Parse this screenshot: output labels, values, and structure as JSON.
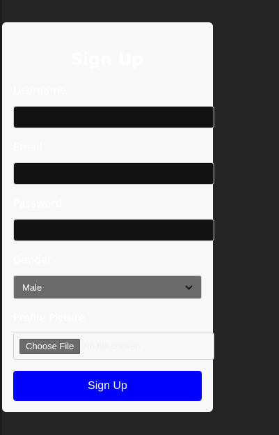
{
  "form": {
    "title": "Sign Up",
    "username_label": "Username",
    "username_value": "",
    "email_label": "Email",
    "email_value": "",
    "password_label": "Password",
    "password_value": "",
    "gender_label": "Gender",
    "gender_selected": "Male",
    "profile_label": "Profile Picture",
    "file_button_label": "Choose File",
    "file_status": "No file chosen",
    "submit_label": "Sign Up"
  },
  "colors": {
    "page_bg": "#252525",
    "card_bg": "#f8f8f8",
    "input_bg": "#121212",
    "select_bg": "#6b6b6b",
    "submit_bg": "#0000ff"
  },
  "icons": {
    "select_arrow": "chevron-down-icon"
  }
}
